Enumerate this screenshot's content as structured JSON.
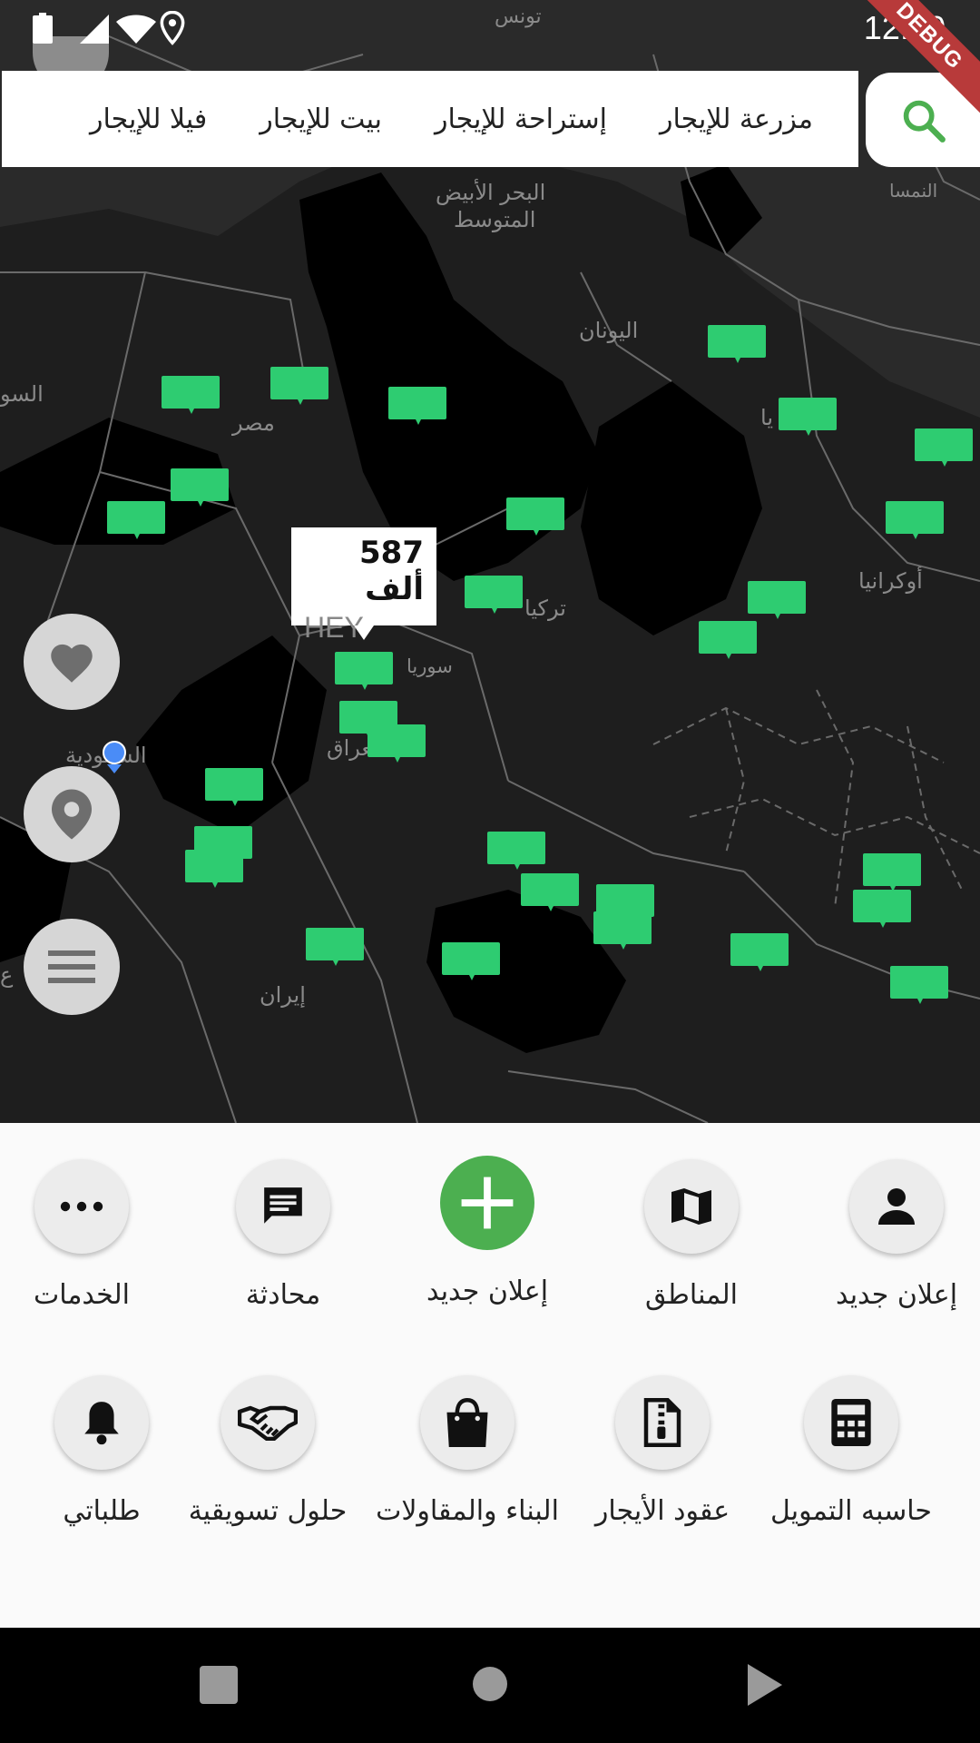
{
  "status_bar": {
    "time": "12:30",
    "debug_label": "DEBUG"
  },
  "search": {
    "tabs": [
      "مزرعة للإيجار",
      "إستراحة للإيجار",
      "بيت للإيجار",
      "فيلا للإيجار"
    ]
  },
  "map": {
    "labels": [
      "تونس",
      "البحر الأبيض",
      "المتوسط",
      "اليونان",
      "مصر",
      "تركيا",
      "سوريا",
      "العراق",
      "السعودية",
      "إيران",
      "أوكرانيا",
      "النمسا",
      "السو",
      "يا",
      "ع"
    ],
    "popup": {
      "price": "587 ألف",
      "note": "HEY"
    },
    "marker_color": "#2ecc71"
  },
  "fabs": [
    "heart-icon",
    "location-pin-icon",
    "menu-icon"
  ],
  "actions_row1": [
    {
      "label": "إعلان جديد",
      "icon": "person-icon"
    },
    {
      "label": "المناطق",
      "icon": "map-icon"
    },
    {
      "label": "إعلان جديد",
      "icon": "plus-icon"
    },
    {
      "label": "محادثة",
      "icon": "chat-icon"
    },
    {
      "label": "الخدمات",
      "icon": "more-icon"
    }
  ],
  "actions_row2": [
    {
      "label": "حاسبه التمويل",
      "icon": "calculator-icon"
    },
    {
      "label": "عقود الأيجار",
      "icon": "zip-file-icon"
    },
    {
      "label": "البناء والمقاولات",
      "icon": "shopping-bag-icon"
    },
    {
      "label": "حلول تسويقية",
      "icon": "handshake-icon"
    },
    {
      "label": "طلباتي",
      "icon": "bell-icon"
    }
  ],
  "colors": {
    "accent": "#4caf50",
    "map_bg": "#1e1e1e",
    "land": "#000000"
  }
}
